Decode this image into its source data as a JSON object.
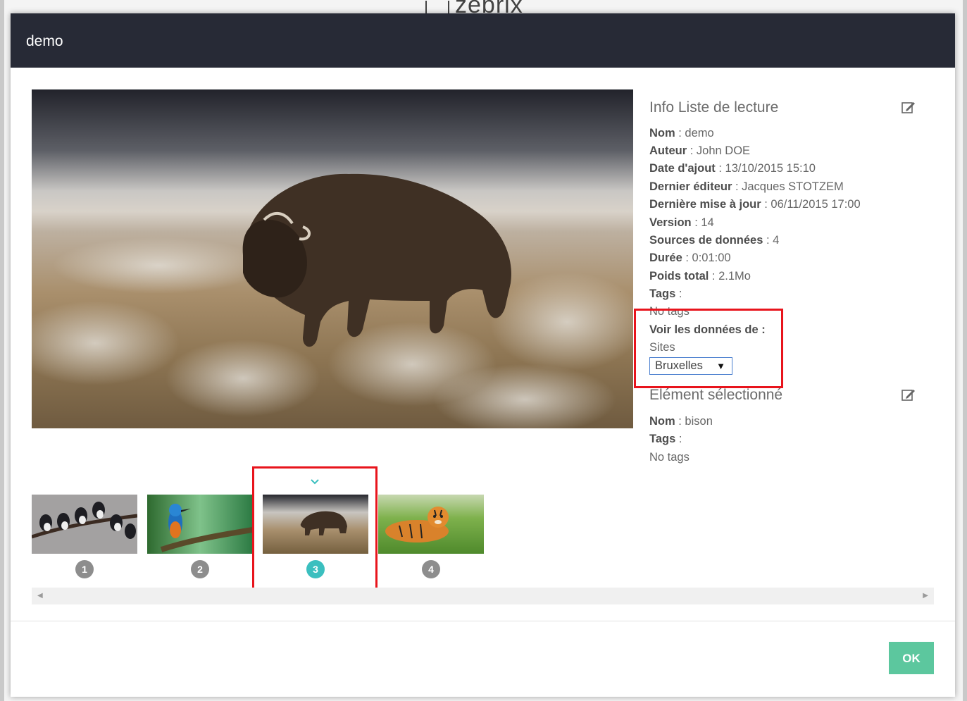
{
  "background": {
    "logo_text": "zebrix"
  },
  "modal": {
    "title": "demo"
  },
  "info": {
    "title": "Info Liste de lecture",
    "rows": [
      {
        "label": "Nom",
        "value": " : demo"
      },
      {
        "label": "Auteur",
        "value": " : John DOE"
      },
      {
        "label": "Date d'ajout",
        "value": " : 13/10/2015 15:10"
      },
      {
        "label": "Dernier éditeur",
        "value": " : Jacques STOTZEM"
      },
      {
        "label": "Dernière mise à jour",
        "value": " : 06/11/2015 17:00"
      },
      {
        "label": "Version",
        "value": " : 14"
      },
      {
        "label": "Sources de données",
        "value": " : 4"
      },
      {
        "label": "Durée",
        "value": " : 0:01:00"
      },
      {
        "label": "Poids total",
        "value": " : 2.1Mo"
      },
      {
        "label": "Tags",
        "value": " :"
      }
    ],
    "tags_value": "No tags",
    "voir_label": "Voir les données de :",
    "sites_label": "Sites",
    "site_select": "Bruxelles"
  },
  "selected": {
    "title": "Elément sélectionné",
    "rows": [
      {
        "label": "Nom",
        "value": " : bison"
      },
      {
        "label": "Tags",
        "value": " :"
      }
    ],
    "tags_value": "No tags"
  },
  "thumbnails": [
    {
      "number": "1",
      "subject": "birds on branch",
      "active": false
    },
    {
      "number": "2",
      "subject": "kingfisher",
      "active": false
    },
    {
      "number": "3",
      "subject": "bison",
      "active": true
    },
    {
      "number": "4",
      "subject": "tiger",
      "active": false
    }
  ],
  "footer": {
    "ok_label": "OK"
  },
  "colors": {
    "header_bg": "#272a36",
    "ok_button": "#5cc79e",
    "active_badge": "#3bbfbf",
    "highlight": "#e8141c"
  }
}
